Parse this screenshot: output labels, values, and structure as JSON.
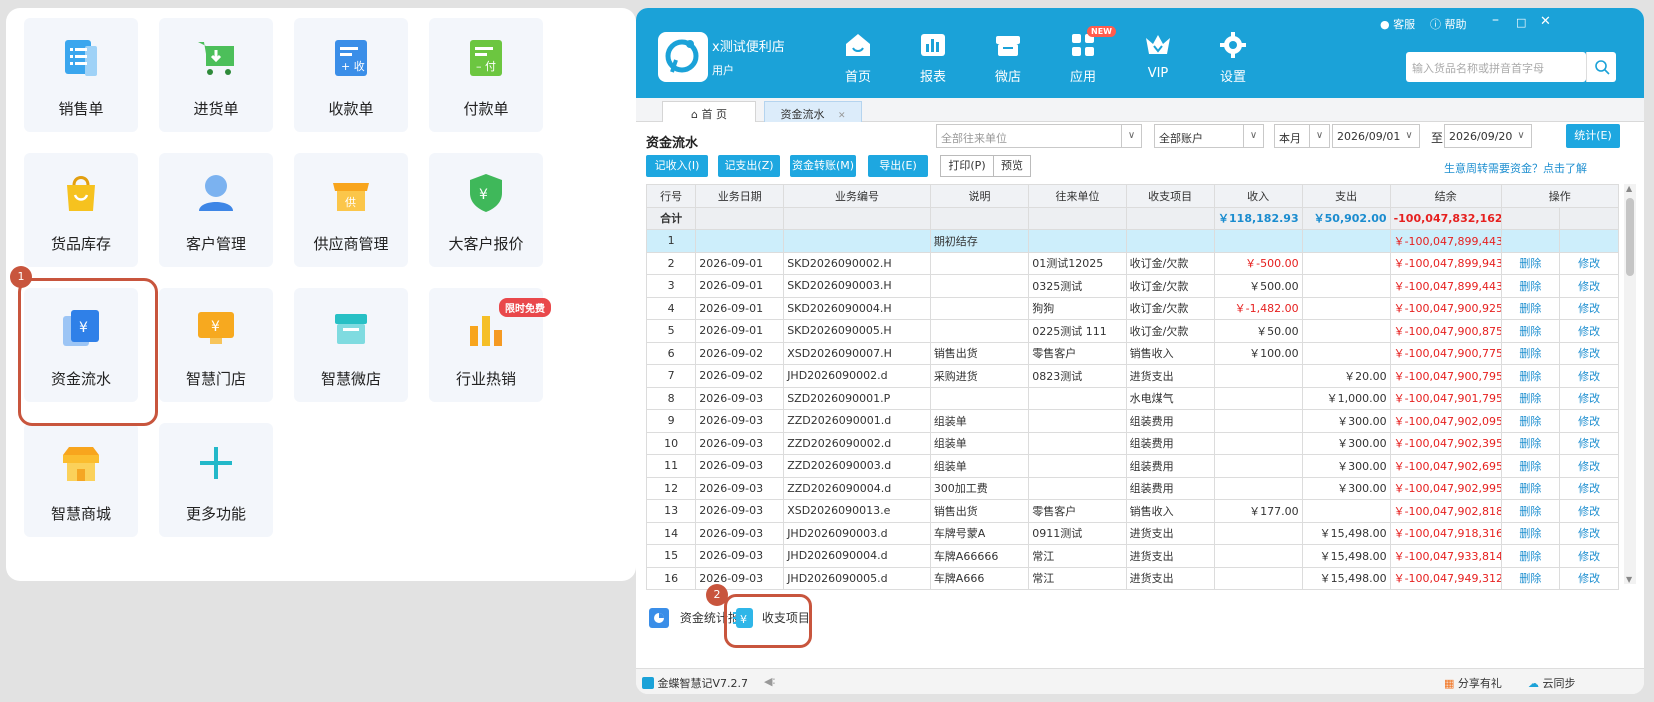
{
  "launcher": {
    "tiles": [
      {
        "label": "销售单",
        "icon": "sales-order-icon"
      },
      {
        "label": "进货单",
        "icon": "purchase-cart-icon"
      },
      {
        "label": "收款单",
        "icon": "receipt-icon"
      },
      {
        "label": "付款单",
        "icon": "payment-icon"
      },
      {
        "label": "货品库存",
        "icon": "inventory-bag-icon"
      },
      {
        "label": "客户管理",
        "icon": "customer-icon"
      },
      {
        "label": "供应商管理",
        "icon": "supplier-icon"
      },
      {
        "label": "大客户报价",
        "icon": "vip-price-shield-icon"
      },
      {
        "label": "资金流水",
        "icon": "cash-flow-icon"
      },
      {
        "label": "智慧门店",
        "icon": "smart-store-icon"
      },
      {
        "label": "智慧微店",
        "icon": "micro-store-icon"
      },
      {
        "label": "行业热销",
        "icon": "hot-sales-chart-icon",
        "badge": "限时免费"
      },
      {
        "label": "智慧商城",
        "icon": "mall-icon"
      },
      {
        "label": "更多功能",
        "icon": "plus-icon"
      }
    ],
    "step_badge": "1"
  },
  "app": {
    "store_name": "x测试便利店",
    "user": "用户",
    "nav": [
      {
        "label": "首页",
        "icon": "home-icon"
      },
      {
        "label": "报表",
        "icon": "report-icon"
      },
      {
        "label": "微店",
        "icon": "shop-icon"
      },
      {
        "label": "应用",
        "icon": "apps-icon",
        "badge": "NEW"
      },
      {
        "label": "VIP",
        "icon": "vip-crown-icon"
      },
      {
        "label": "设置",
        "icon": "gear-icon"
      }
    ],
    "window_controls": {
      "service": "客服",
      "help": "帮助"
    },
    "search_placeholder": "输入货品名称或拼音首字母",
    "tabs": [
      {
        "label": "首 页"
      },
      {
        "label": "资金流水"
      }
    ],
    "page_title": "资金流水",
    "filters": {
      "partner": "全部往来单位",
      "account": "全部账户",
      "period": "本月",
      "date_from": "2026/09/01",
      "to_label": "至",
      "date_to": "2026/09/20",
      "stat_button": "统计(E)"
    },
    "actions": {
      "income": "记收入(I)",
      "expense": "记支出(Z)",
      "transfer": "资金转账(M)",
      "export": "导出(E)",
      "print": "打印(P)",
      "preview": "预览",
      "hint": "生意周转需要资金？点击了解"
    },
    "table": {
      "headers": [
        "行号",
        "业务日期",
        "业务编号",
        "说明",
        "往来单位",
        "收支项目",
        "收入",
        "支出",
        "结余",
        "操作"
      ],
      "sum_label": "合计",
      "sum_income": "￥118,182.93",
      "sum_expense": "￥50,902.00",
      "sum_balance": "-100,047,832,162.36",
      "delete_label": "删除",
      "edit_label": "修改",
      "opening": {
        "no": "1",
        "desc": "期初结存",
        "balance": "￥-100,047,899,443.29"
      },
      "rows": [
        {
          "no": "2",
          "date": "2026-09-01",
          "code": "SKD2026090002.H",
          "desc": "",
          "partner": "01测试12025",
          "item": "收订金/欠款",
          "income": "￥-500.00",
          "income_red": true,
          "expense": "",
          "balance": "￥-100,047,899,943.29"
        },
        {
          "no": "3",
          "date": "2026-09-01",
          "code": "SKD2026090003.H",
          "desc": "",
          "partner": "0325测试",
          "item": "收订金/欠款",
          "income": "￥500.00",
          "income_red": false,
          "expense": "",
          "balance": "￥-100,047,899,443.29"
        },
        {
          "no": "4",
          "date": "2026-09-01",
          "code": "SKD2026090004.H",
          "desc": "",
          "partner": "狗狗",
          "item": "收订金/欠款",
          "income": "￥-1,482.00",
          "income_red": true,
          "expense": "",
          "balance": "￥-100,047,900,925.29"
        },
        {
          "no": "5",
          "date": "2026-09-01",
          "code": "SKD2026090005.H",
          "desc": "",
          "partner": "0225测试 111",
          "item": "收订金/欠款",
          "income": "￥50.00",
          "income_red": false,
          "expense": "",
          "balance": "￥-100,047,900,875.29"
        },
        {
          "no": "6",
          "date": "2026-09-02",
          "code": "XSD2026090007.H",
          "desc": "销售出货",
          "partner": "零售客户",
          "item": "销售收入",
          "income": "￥100.00",
          "income_red": false,
          "expense": "",
          "balance": "￥-100,047,900,775.29"
        },
        {
          "no": "7",
          "date": "2026-09-02",
          "code": "JHD2026090002.d",
          "desc": "采购进货",
          "partner": "0823测试",
          "item": "进货支出",
          "income": "",
          "income_red": false,
          "expense": "￥20.00",
          "balance": "￥-100,047,900,795.29"
        },
        {
          "no": "8",
          "date": "2026-09-03",
          "code": "SZD2026090001.P",
          "desc": "",
          "partner": "",
          "item": "水电煤气",
          "income": "",
          "income_red": false,
          "expense": "￥1,000.00",
          "balance": "￥-100,047,901,795.29"
        },
        {
          "no": "9",
          "date": "2026-09-03",
          "code": "ZZD2026090001.d",
          "desc": "组装单",
          "partner": "",
          "item": "组装费用",
          "income": "",
          "income_red": false,
          "expense": "￥300.00",
          "balance": "￥-100,047,902,095.29"
        },
        {
          "no": "10",
          "date": "2026-09-03",
          "code": "ZZD2026090002.d",
          "desc": "组装单",
          "partner": "",
          "item": "组装费用",
          "income": "",
          "income_red": false,
          "expense": "￥300.00",
          "balance": "￥-100,047,902,395.29"
        },
        {
          "no": "11",
          "date": "2026-09-03",
          "code": "ZZD2026090003.d",
          "desc": "组装单",
          "partner": "",
          "item": "组装费用",
          "income": "",
          "income_red": false,
          "expense": "￥300.00",
          "balance": "￥-100,047,902,695.29"
        },
        {
          "no": "12",
          "date": "2026-09-03",
          "code": "ZZD2026090004.d",
          "desc": "300加工费",
          "partner": "",
          "item": "组装费用",
          "income": "",
          "income_red": false,
          "expense": "￥300.00",
          "balance": "￥-100,047,902,995.29"
        },
        {
          "no": "13",
          "date": "2026-09-03",
          "code": "XSD2026090013.e",
          "desc": "销售出货",
          "partner": "零售客户",
          "item": "销售收入",
          "income": "￥177.00",
          "income_red": false,
          "expense": "",
          "balance": "￥-100,047,902,818.29"
        },
        {
          "no": "14",
          "date": "2026-09-03",
          "code": "JHD2026090003.d",
          "desc": "车牌号蒙A",
          "partner": "0911测试",
          "item": "进货支出",
          "income": "",
          "income_red": false,
          "expense": "￥15,498.00",
          "balance": "￥-100,047,918,316.29"
        },
        {
          "no": "15",
          "date": "2026-09-03",
          "code": "JHD2026090004.d",
          "desc": "车牌A66666",
          "partner": "常江",
          "item": "进货支出",
          "income": "",
          "income_red": false,
          "expense": "￥15,498.00",
          "balance": "￥-100,047,933,814.29"
        },
        {
          "no": "16",
          "date": "2026-09-03",
          "code": "JHD2026090005.d",
          "desc": "车牌A666",
          "partner": "常江",
          "item": "进货支出",
          "income": "",
          "income_red": false,
          "expense": "￥15,498.00",
          "balance": "￥-100,047,949,312.29"
        }
      ]
    },
    "bottom": {
      "report": "资金统计报告",
      "items": "收支项目",
      "step_badge": "2"
    },
    "status": {
      "version": "金蝶智慧记V7.2.7",
      "share": "分享有礼",
      "sync": "云同步"
    }
  }
}
